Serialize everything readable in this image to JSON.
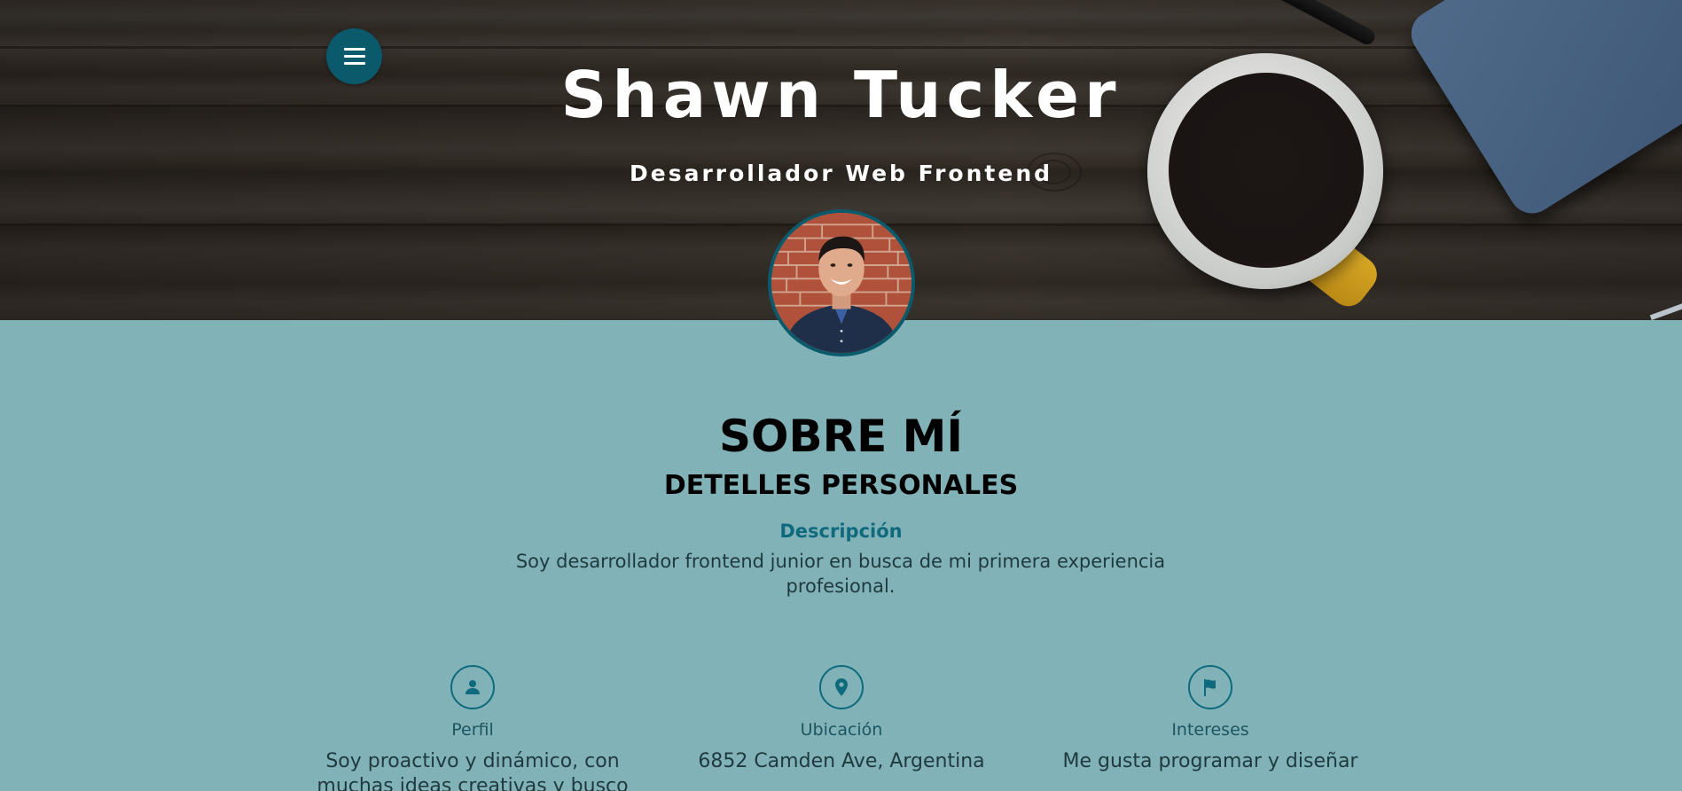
{
  "hero": {
    "title": "Shawn Tucker",
    "subtitle": "Desarrollador Web Frontend",
    "menu_icon": "hamburger-menu-icon"
  },
  "about": {
    "title": "SOBRE MÍ",
    "subtitle": "DETELLES PERSONALES",
    "description_heading": "Descripción",
    "description_text": "Soy desarrollador frontend junior en busca de mi primera experiencia profesional."
  },
  "details": [
    {
      "icon": "user-icon",
      "label": "Perfil",
      "text": "Soy proactivo y dinámico, con muchas ideas creativas y busco"
    },
    {
      "icon": "map-pin-icon",
      "label": "Ubicación",
      "text": "6852 Camden Ave, Argentina"
    },
    {
      "icon": "flag-icon",
      "label": "Intereses",
      "text": "Me gusta programar y diseñar"
    }
  ],
  "colors": {
    "page_background": "#80b2b8",
    "accent": "#0b5a6c",
    "heading_accent": "#0e6a7c"
  }
}
